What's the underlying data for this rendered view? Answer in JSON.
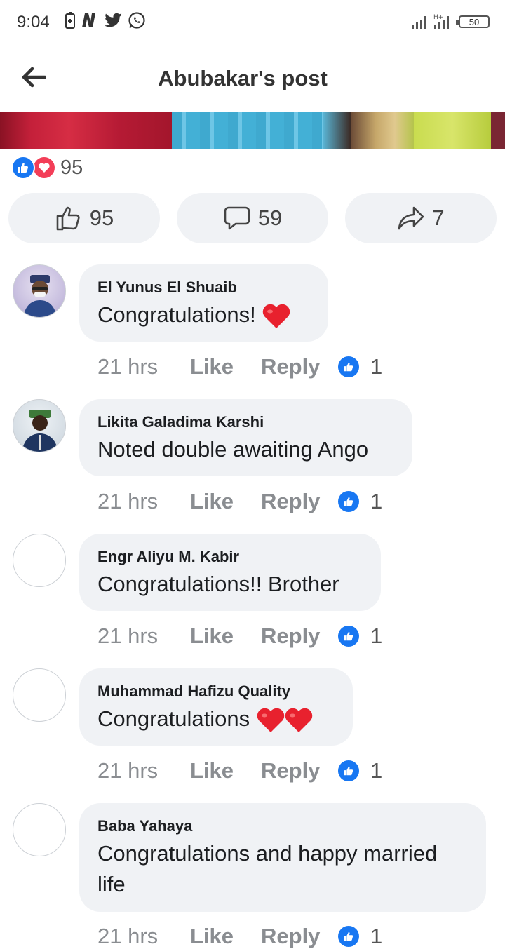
{
  "status_bar": {
    "time": "9:04",
    "battery": "50"
  },
  "header": {
    "title": "Abubakar's post"
  },
  "reactions": {
    "count": "95"
  },
  "actions": {
    "like_count": "95",
    "comment_count": "59",
    "share_count": "7"
  },
  "comments": [
    {
      "name": "El Yunus El Shuaib",
      "text": "Congratulations!",
      "hearts": 1,
      "time": "21 hrs",
      "like": "Like",
      "reply": "Reply",
      "reaction_count": "1"
    },
    {
      "name": "Likita Galadima Karshi",
      "text": "Noted double awaiting Ango",
      "hearts": 0,
      "time": "21 hrs",
      "like": "Like",
      "reply": "Reply",
      "reaction_count": "1"
    },
    {
      "name": "Engr Aliyu M. Kabir",
      "text": "Congratulations!! Brother",
      "hearts": 0,
      "time": "21 hrs",
      "like": "Like",
      "reply": "Reply",
      "reaction_count": "1"
    },
    {
      "name": "Muhammad Hafizu Quality",
      "text": "Congratulations",
      "hearts": 2,
      "time": "21 hrs",
      "like": "Like",
      "reply": "Reply",
      "reaction_count": "1"
    },
    {
      "name": "Baba Yahaya",
      "text": "Congratulations and happy married life",
      "hearts": 0,
      "time": "21 hrs",
      "like": "Like",
      "reply": "Reply",
      "reaction_count": "1"
    }
  ],
  "colors": {
    "facebook_blue": "#1877f2",
    "love_red": "#f33e58",
    "bubble_bg": "#f0f2f5",
    "meta_gray": "#8a8d91"
  }
}
